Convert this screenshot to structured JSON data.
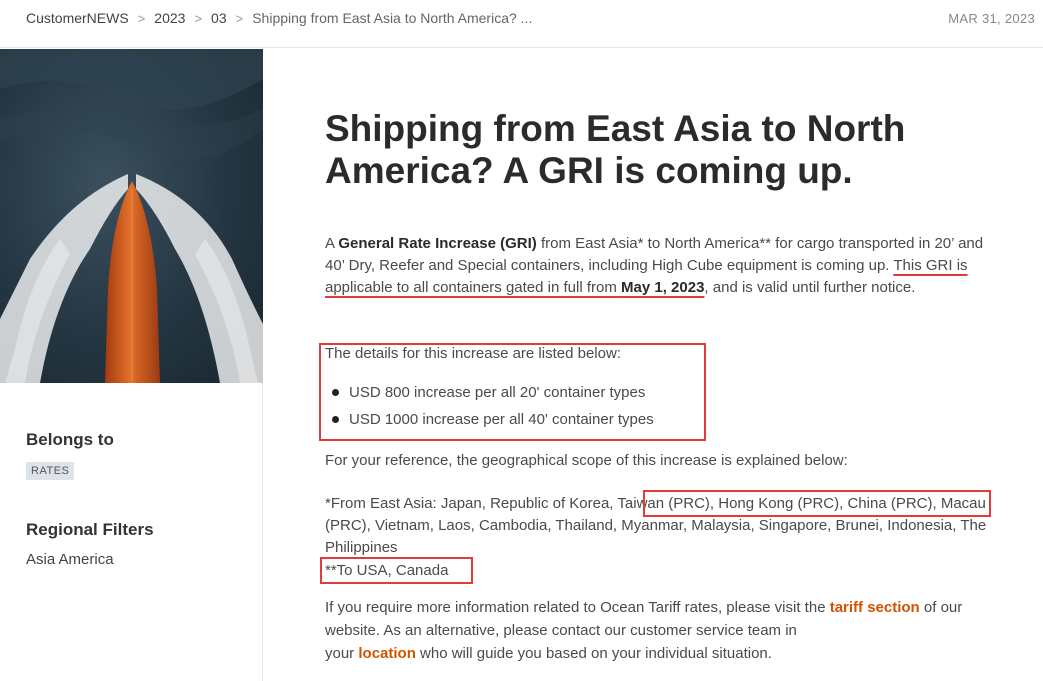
{
  "breadcrumb": {
    "items": [
      "CustomerNEWS",
      "2023",
      "03"
    ],
    "current": "Shipping from East Asia to North America? ...",
    "separator": ">"
  },
  "date": "MAR 31, 2023",
  "sidebar": {
    "belongs_label": "Belongs to",
    "tag": "RATES",
    "filters_label": "Regional Filters",
    "filters_value": "Asia America"
  },
  "article": {
    "title": "Shipping from East Asia to North America? A GRI is coming up.",
    "intro": {
      "a": "A ",
      "b1": "General Rate Increase (GRI)",
      "c": " from East Asia* to North America** for cargo transported in 20’ and 40’ Dry, Reefer and Special containers, including High Cube equipment is coming up. ",
      "u1": "This GRI is applicable to all containers gated in full from ",
      "u2": "May 1, 2023",
      "d": ", and is valid until further notice."
    },
    "details_heading": "The details for this increase are listed below:",
    "details": [
      "USD 800 increase per all 20' container types",
      "USD 1000 increase per all 40' container types"
    ],
    "scope_heading": "For your reference, the geographical scope of this increase is explained below:",
    "from": {
      "prefix": "*From East Asia: Japan, Republic of Korea, ",
      "highlight": "Taiwan (PRC), Hong Kong (PRC), China (PRC)",
      "rest": ", Macau (PRC), Vietnam, Laos, Cambodia, Thailand, Myanmar, Malaysia, Singapore, Brunei, Indonesia, The Philippines"
    },
    "to": "**To USA, Canada",
    "contact": {
      "a": "If you require more information related to Ocean Tariff rates, please visit the ",
      "link1": "tariff section",
      "b": " of our website. As an alternative, please contact our customer service team in ",
      "c": "your ",
      "link2": "location",
      "d": " who will guide you based on your individual situation."
    }
  },
  "colors": {
    "accent": "#d35400",
    "highlight_box": "#e23b3b",
    "tag_bg": "#dde3e8"
  }
}
